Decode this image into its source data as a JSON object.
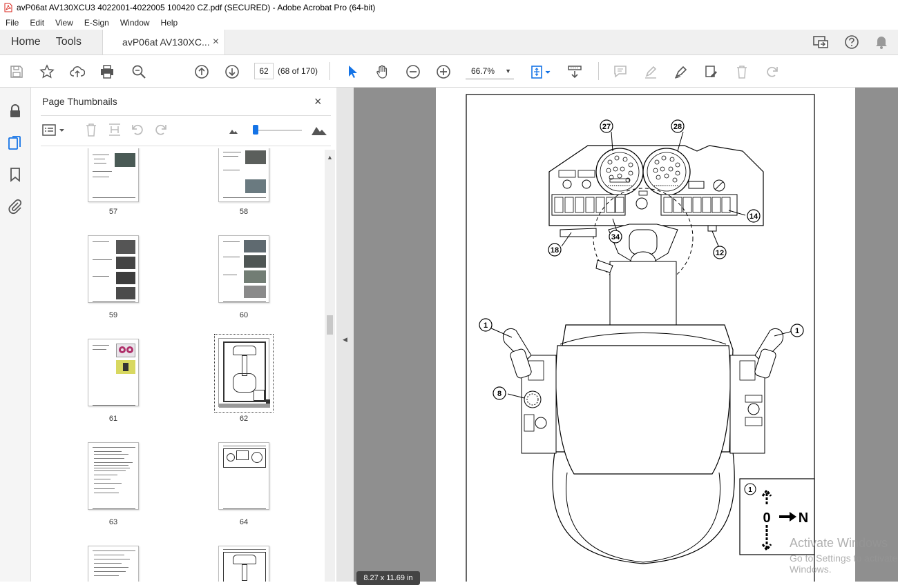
{
  "window": {
    "title": "avP06at AV130XCU3 4022001-4022005 100420 CZ.pdf (SECURED) - Adobe Acrobat Pro (64-bit)"
  },
  "menu": [
    "File",
    "Edit",
    "View",
    "E-Sign",
    "Window",
    "Help"
  ],
  "tabs": {
    "home": "Home",
    "tools": "Tools",
    "doc": "avP06at AV130XC...",
    "doc_close": "×"
  },
  "toolbar": {
    "page_current": "62",
    "page_count": "(68 of 170)",
    "zoom": "66.7%"
  },
  "thumb_panel": {
    "title": "Page Thumbnails",
    "close": "×",
    "thumbs": [
      {
        "label": "57"
      },
      {
        "label": "58"
      },
      {
        "label": "59"
      },
      {
        "label": "60"
      },
      {
        "label": "61"
      },
      {
        "label": "62"
      },
      {
        "label": "63"
      },
      {
        "label": "64"
      }
    ]
  },
  "drawing": {
    "callouts": [
      "27",
      "28",
      "14",
      "34",
      "18",
      "12",
      "1",
      "1",
      "8"
    ],
    "legend_num": "1",
    "legend_zero": "0",
    "legend_n": "N"
  },
  "status": {
    "page_size": "8.27 x 11.69 in"
  },
  "watermark": {
    "line1": "Activate Windows",
    "line2": "Go to Settings to activate Windows."
  },
  "colors": {
    "accent": "#1473e6",
    "pdf_red": "#d9261c"
  }
}
